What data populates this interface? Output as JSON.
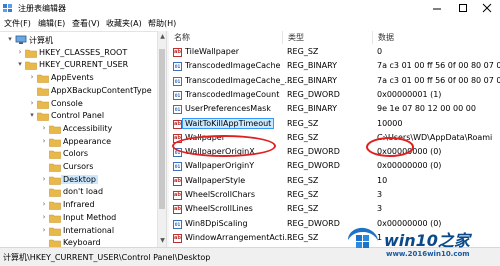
{
  "window": {
    "title": "注册表编辑器"
  },
  "menu": [
    "文件(F)",
    "编辑(E)",
    "查看(V)",
    "收藏夹(A)",
    "帮助(H)"
  ],
  "tree": [
    {
      "label": "计算机",
      "level": 0,
      "caret": "▾",
      "icon": "computer"
    },
    {
      "label": "HKEY_CLASSES_ROOT",
      "level": 1,
      "caret": "›",
      "icon": "folder"
    },
    {
      "label": "HKEY_CURRENT_USER",
      "level": 1,
      "caret": "▾",
      "icon": "folder"
    },
    {
      "label": "AppEvents",
      "level": 2,
      "caret": "›",
      "icon": "folder"
    },
    {
      "label": "AppXBackupContentType",
      "level": 2,
      "caret": "",
      "icon": "folder"
    },
    {
      "label": "Console",
      "level": 2,
      "caret": "›",
      "icon": "folder"
    },
    {
      "label": "Control Panel",
      "level": 2,
      "caret": "▾",
      "icon": "folder"
    },
    {
      "label": "Accessibility",
      "level": 3,
      "caret": "›",
      "icon": "folder"
    },
    {
      "label": "Appearance",
      "level": 3,
      "caret": "›",
      "icon": "folder"
    },
    {
      "label": "Colors",
      "level": 3,
      "caret": "",
      "icon": "folder"
    },
    {
      "label": "Cursors",
      "level": 3,
      "caret": "",
      "icon": "folder"
    },
    {
      "label": "Desktop",
      "level": 3,
      "caret": "›",
      "icon": "folder",
      "selected": true
    },
    {
      "label": "don't load",
      "level": 3,
      "caret": "",
      "icon": "folder"
    },
    {
      "label": "Infrared",
      "level": 3,
      "caret": "›",
      "icon": "folder"
    },
    {
      "label": "Input Method",
      "level": 3,
      "caret": "›",
      "icon": "folder"
    },
    {
      "label": "International",
      "level": 3,
      "caret": "›",
      "icon": "folder"
    },
    {
      "label": "Keyboard",
      "level": 3,
      "caret": "",
      "icon": "folder"
    }
  ],
  "columns": {
    "name": "名称",
    "type": "类型",
    "data": "数据"
  },
  "values": [
    {
      "name": "TileWallpaper",
      "type": "REG_SZ",
      "data": "0",
      "icon": "string"
    },
    {
      "name": "TranscodedImageCache",
      "type": "REG_BINARY",
      "data": "7a c3 01 00 ff 56 0f 00 80 07 0",
      "icon": "binary"
    },
    {
      "name": "TranscodedImageCache_...",
      "type": "REG_BINARY",
      "data": "7a c3 01 00 ff 56 0f 00 80 07 0",
      "icon": "binary"
    },
    {
      "name": "TranscodedImageCount",
      "type": "REG_DWORD",
      "data": "0x00000001 (1)",
      "icon": "binary"
    },
    {
      "name": "UserPreferencesMask",
      "type": "REG_BINARY",
      "data": "9e 1e 07 80 12 00 00 00",
      "icon": "binary"
    },
    {
      "name": "WaitToKillAppTimeout",
      "type": "REG_SZ",
      "data": "10000",
      "icon": "string",
      "selected": true
    },
    {
      "name": "Wallpaper",
      "type": "REG_SZ",
      "data": "C:\\Users\\WD\\AppData\\Roami",
      "icon": "string"
    },
    {
      "name": "WallpaperOriginX",
      "type": "REG_DWORD",
      "data": "0x00000000 (0)",
      "icon": "binary"
    },
    {
      "name": "WallpaperOriginY",
      "type": "REG_DWORD",
      "data": "0x00000000 (0)",
      "icon": "binary"
    },
    {
      "name": "WallpaperStyle",
      "type": "REG_SZ",
      "data": "10",
      "icon": "string"
    },
    {
      "name": "WheelScrollChars",
      "type": "REG_SZ",
      "data": "3",
      "icon": "string"
    },
    {
      "name": "WheelScrollLines",
      "type": "REG_SZ",
      "data": "3",
      "icon": "string"
    },
    {
      "name": "Win8DpiScaling",
      "type": "REG_DWORD",
      "data": "0x00000000 (0)",
      "icon": "binary"
    },
    {
      "name": "WindowArrangementActi...",
      "type": "REG_SZ",
      "data": "1",
      "icon": "string"
    }
  ],
  "statusbar": {
    "path": "计算机\\HKEY_CURRENT_USER\\Control Panel\\Desktop"
  },
  "watermark": {
    "brand": "win10之家",
    "url": "www.2016win10.com"
  },
  "colors": {
    "highlight_oval": "#e02020",
    "selection": "#cce8ff",
    "folder": "#e8b84a"
  }
}
